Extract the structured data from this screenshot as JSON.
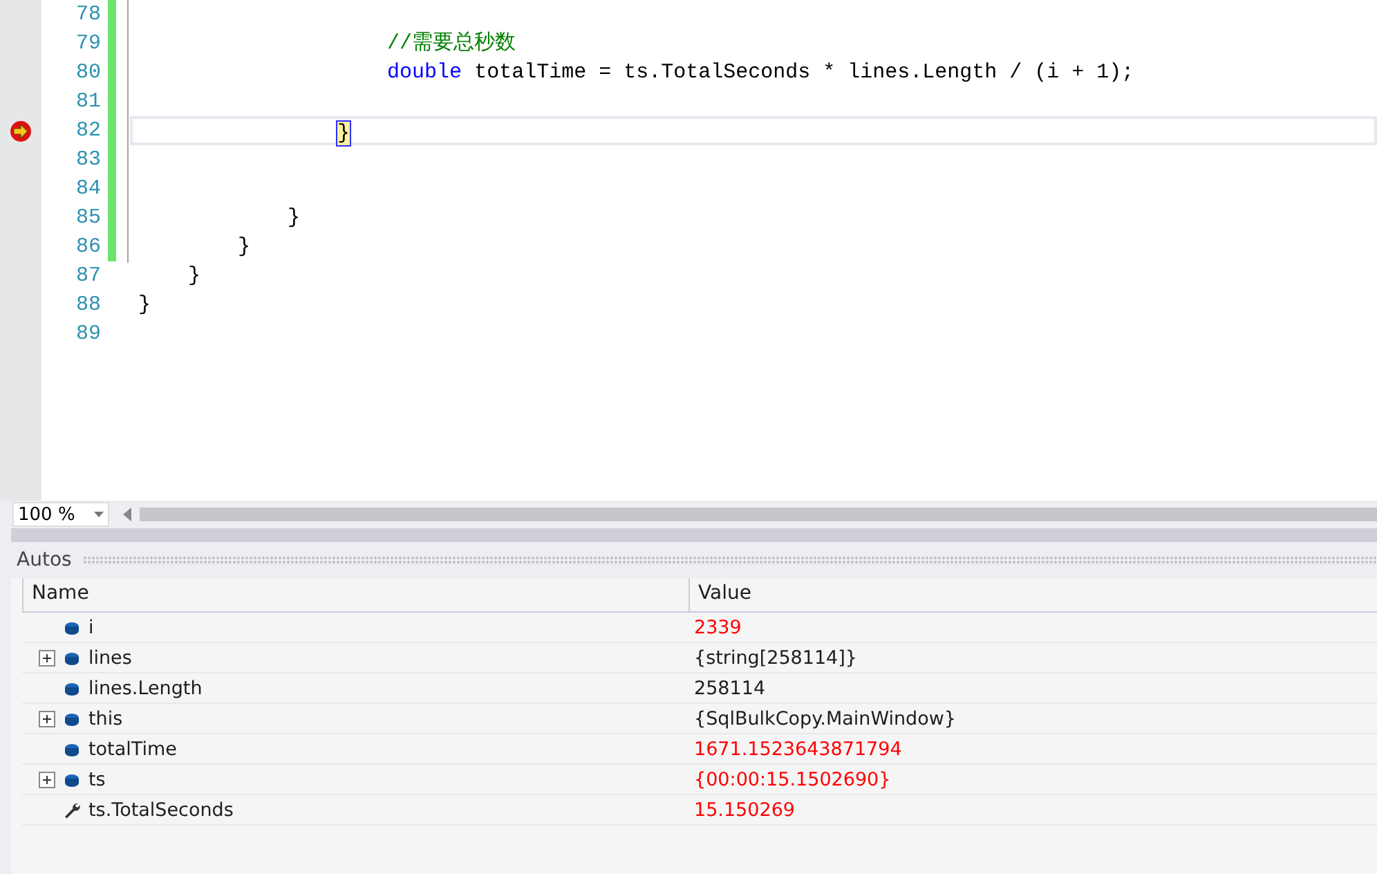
{
  "editor": {
    "lines": [
      {
        "number": "78",
        "changed": true,
        "current": false
      },
      {
        "number": "79",
        "changed": true,
        "current": false,
        "tokens": [
          {
            "kind": "comment",
            "text": "                    //需要总秒数"
          }
        ]
      },
      {
        "number": "80",
        "changed": true,
        "current": false,
        "tokens": [
          {
            "kind": "keyword",
            "text": "                    double"
          },
          {
            "kind": "plain",
            "text": " totalTime = ts.TotalSeconds * lines.Length / (i + 1);"
          }
        ]
      },
      {
        "number": "81",
        "changed": true,
        "current": false
      },
      {
        "number": "82",
        "changed": true,
        "current": true,
        "tokens": [
          {
            "kind": "highlight",
            "text": "                }"
          }
        ]
      },
      {
        "number": "83",
        "changed": true,
        "current": false
      },
      {
        "number": "84",
        "changed": true,
        "current": false
      },
      {
        "number": "85",
        "changed": true,
        "current": false,
        "tokens": [
          {
            "kind": "plain",
            "text": "            }"
          }
        ]
      },
      {
        "number": "86",
        "changed": true,
        "current": false,
        "tokens": [
          {
            "kind": "plain",
            "text": "        }"
          }
        ]
      },
      {
        "number": "87",
        "changed": false,
        "current": false,
        "tokens": [
          {
            "kind": "plain",
            "text": "    }"
          }
        ]
      },
      {
        "number": "88",
        "changed": false,
        "current": false,
        "tokens": [
          {
            "kind": "plain",
            "text": "}"
          }
        ]
      },
      {
        "number": "89",
        "changed": false,
        "current": false
      }
    ],
    "zoom": "100 %"
  },
  "autos": {
    "title": "Autos",
    "columns": [
      "Name",
      "Value"
    ],
    "rows": [
      {
        "kind": "field",
        "expandable": false,
        "name": "i",
        "value": "2339",
        "changed": true
      },
      {
        "kind": "field",
        "expandable": true,
        "expanded": false,
        "name": "lines",
        "value": "{string[258114]}",
        "changed": false
      },
      {
        "kind": "field",
        "expandable": false,
        "name": "lines.Length",
        "value": "258114",
        "changed": false
      },
      {
        "kind": "field",
        "expandable": true,
        "expanded": false,
        "name": "this",
        "value": "{SqlBulkCopy.MainWindow}",
        "changed": false
      },
      {
        "kind": "field",
        "expandable": false,
        "name": "totalTime",
        "value": "1671.1523643871794",
        "changed": true
      },
      {
        "kind": "field",
        "expandable": true,
        "expanded": false,
        "name": "ts",
        "value": "{00:00:15.1502690}",
        "changed": true
      },
      {
        "kind": "property",
        "expandable": false,
        "name": "ts.TotalSeconds",
        "value": "15.150269",
        "changed": true
      }
    ]
  }
}
